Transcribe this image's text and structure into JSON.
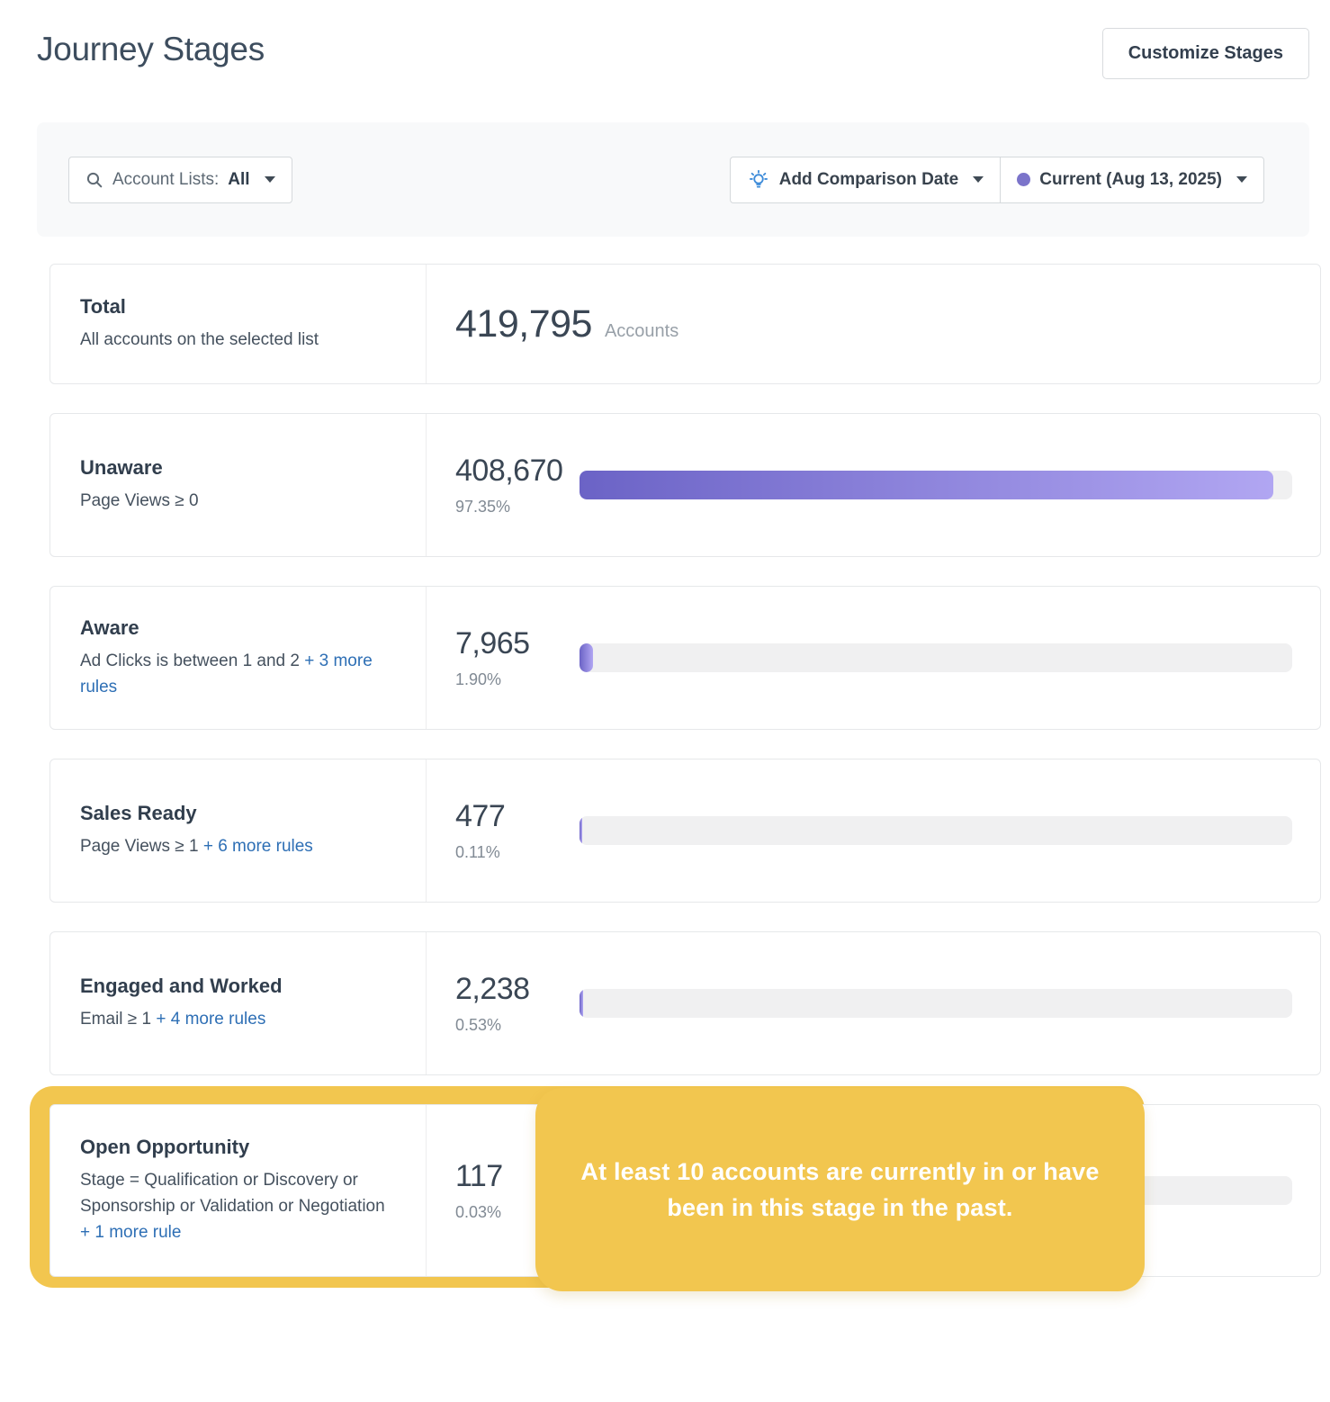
{
  "page": {
    "title": "Journey Stages"
  },
  "header": {
    "customize_button": "Customize Stages"
  },
  "filters": {
    "account_lists": {
      "label": "Account Lists:",
      "value": "All"
    },
    "add_comparison_label": "Add Comparison Date",
    "current_date_label": "Current (Aug 13, 2025)"
  },
  "total_row": {
    "title": "Total",
    "description": "All accounts on the selected list",
    "value": "419,795",
    "unit": "Accounts"
  },
  "stages": [
    {
      "name": "Unaware",
      "rule": "Page Views ≥ 0",
      "more": "",
      "value": "408,670",
      "percent": "97.35%",
      "bar_percent": 97.35,
      "highlighted": false
    },
    {
      "name": "Aware",
      "rule": "Ad Clicks is between 1 and 2",
      "more": "+ 3 more rules",
      "value": "7,965",
      "percent": "1.90%",
      "bar_percent": 1.9,
      "highlighted": false
    },
    {
      "name": "Sales Ready",
      "rule": "Page Views ≥ 1",
      "more": "+ 6 more rules",
      "value": "477",
      "percent": "0.11%",
      "bar_percent": 0.11,
      "highlighted": false
    },
    {
      "name": "Engaged and Worked",
      "rule": "Email ≥ 1",
      "more": "+ 4 more rules",
      "value": "2,238",
      "percent": "0.53%",
      "bar_percent": 0.53,
      "highlighted": false
    },
    {
      "name": "Open Opportunity",
      "rule": "Stage = Qualification or Discovery or Sponsorship or Validation or Negotiation",
      "more": "+ 1 more rule",
      "value": "117",
      "percent": "0.03%",
      "bar_percent": 0.03,
      "highlighted": true
    }
  ],
  "tooltip": {
    "text": "At least 10 accounts are currently in or have been in this stage in the past."
  },
  "icons": {
    "search": "search-icon",
    "bulb": "lightbulb-icon",
    "dot": "current-date-dot",
    "caret": "chevron-down-icon"
  },
  "colors": {
    "highlight_yellow": "#f2c64f",
    "bar_purple_dark": "#6b63c6",
    "bar_purple_light": "#b1a6f2",
    "small_bar_purple": "#7e76cf",
    "dot_purple": "#7b74ca",
    "link_blue": "#2e6fb5",
    "bulb_blue": "#3e8cd9",
    "track_gray": "#f0f0f1"
  }
}
